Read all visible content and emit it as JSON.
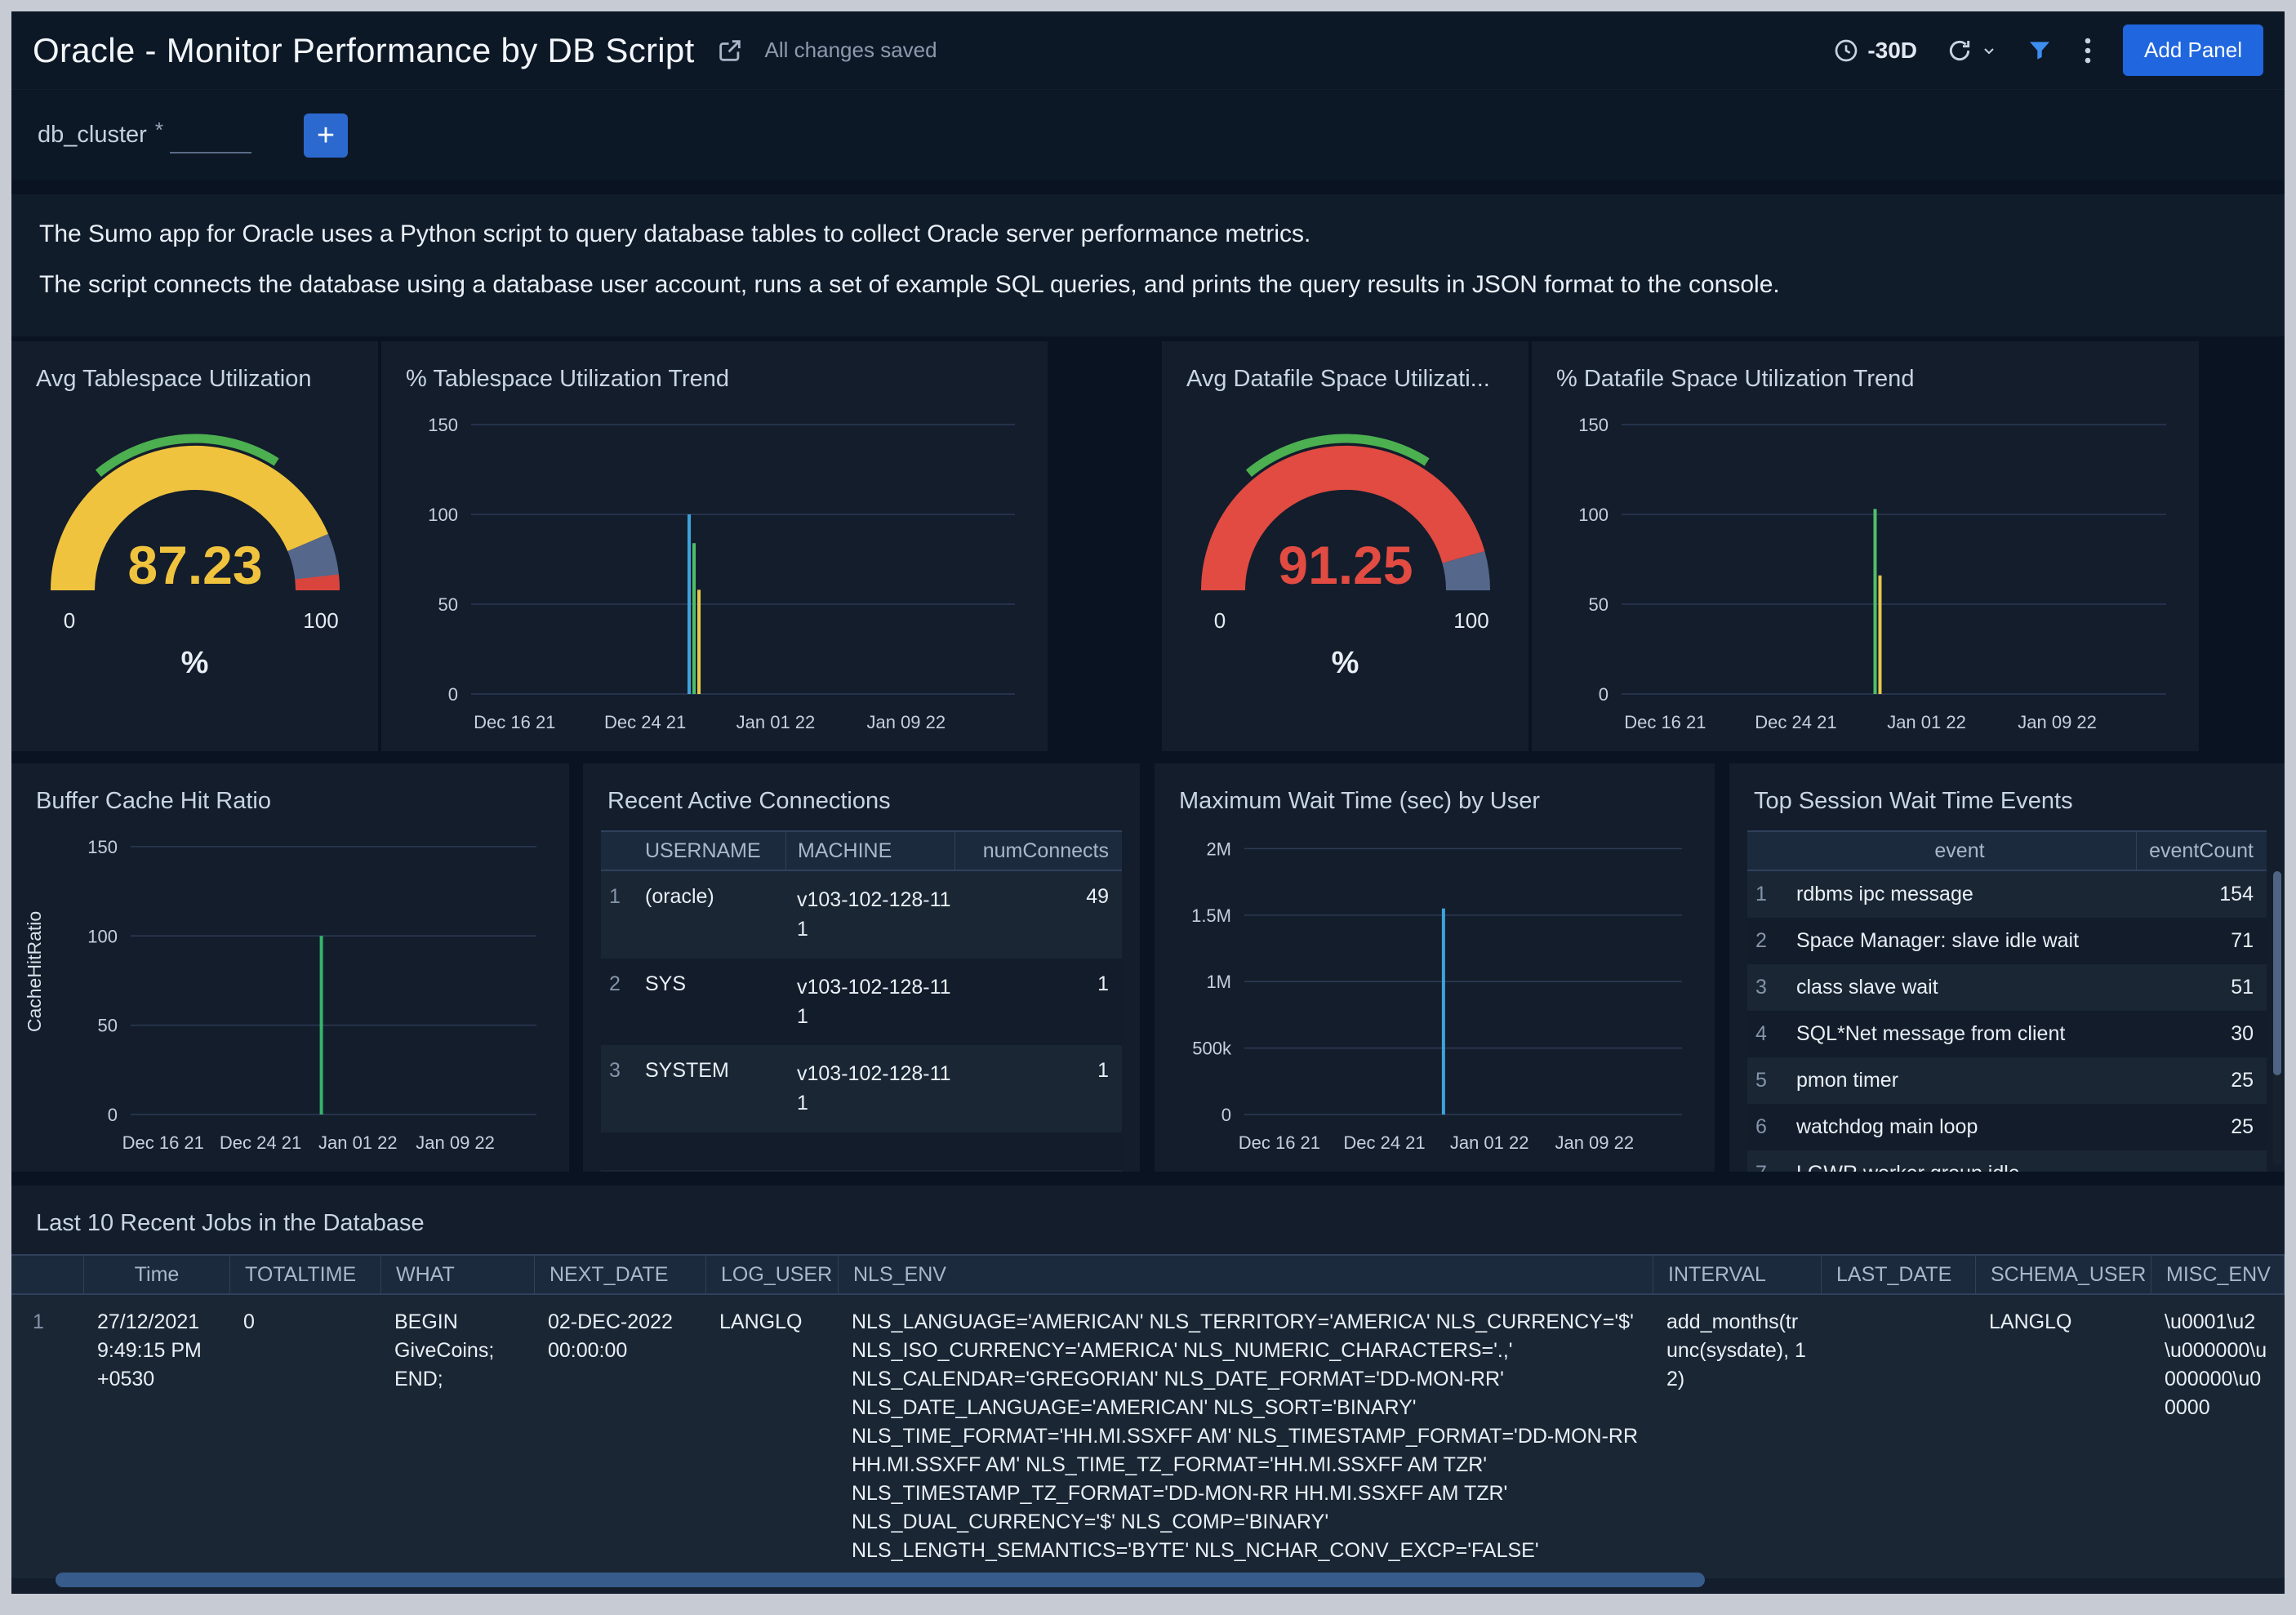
{
  "header": {
    "title": "Oracle - Monitor Performance by DB Script",
    "status": "All changes saved",
    "time_range": "-30D",
    "add_panel": "Add Panel"
  },
  "filter": {
    "label": "db_cluster",
    "required": "*",
    "value": "",
    "add": "+"
  },
  "description": {
    "p1": "The Sumo app for Oracle uses a Python script to query database tables to collect Oracle server performance metrics.",
    "p2": "The script connects the database using a database user account, runs a set of example SQL queries, and prints the query results in JSON format to the console."
  },
  "colors": {
    "accent_blue": "#1F66DF",
    "gauge_yellow": "#F0C33E",
    "gauge_red": "#E14B41",
    "gauge_rest": "#55678B",
    "gauge_band_green": "#4CAF50",
    "spike_blue": "#3FA3DC",
    "spike_green": "#4FC06A",
    "spike_yellow": "#E8C84C"
  },
  "panels": {
    "avg_tablespace": {
      "title": "Avg Tablespace Utilization",
      "unit": "%"
    },
    "tablespace_trend": {
      "title": "% Tablespace Utilization Trend"
    },
    "avg_datafile": {
      "title": "Avg Datafile Space Utilizati...",
      "unit": "%"
    },
    "datafile_trend": {
      "title": "% Datafile Space Utilization Trend"
    },
    "buffer_cache": {
      "title": "Buffer Cache Hit Ratio"
    },
    "connections": {
      "title": "Recent Active Connections",
      "columns": [
        "USERNAME",
        "MACHINE",
        "numConnects"
      ],
      "rows": [
        {
          "n": "1",
          "username": "(oracle)",
          "machine": "v103-102-128-111",
          "numConnects": "49"
        },
        {
          "n": "2",
          "username": "SYS",
          "machine": "v103-102-128-111",
          "numConnects": "1"
        },
        {
          "n": "3",
          "username": "SYSTEM",
          "machine": "v103-102-128-111",
          "numConnects": "1"
        }
      ]
    },
    "max_wait": {
      "title": "Maximum Wait Time (sec) by User"
    },
    "top_wait": {
      "title": "Top Session Wait Time Events",
      "columns": [
        "event",
        "eventCount"
      ],
      "rows": [
        {
          "n": "1",
          "event": "rdbms ipc message",
          "count": "154"
        },
        {
          "n": "2",
          "event": "Space Manager: slave idle wait",
          "count": "71"
        },
        {
          "n": "3",
          "event": "class slave wait",
          "count": "51"
        },
        {
          "n": "4",
          "event": "SQL*Net message from client",
          "count": "30"
        },
        {
          "n": "5",
          "event": "pmon timer",
          "count": "25"
        },
        {
          "n": "6",
          "event": "watchdog main loop",
          "count": "25"
        },
        {
          "n": "7",
          "event": "LGWR worker group idle",
          "count": ""
        }
      ]
    },
    "jobs": {
      "title": "Last 10 Recent Jobs in the Database",
      "columns": [
        "Time",
        "TOTALTIME",
        "WHAT",
        "NEXT_DATE",
        "LOG_USER",
        "NLS_ENV",
        "INTERVAL",
        "LAST_DATE",
        "SCHEMA_USER",
        "MISC_ENV"
      ],
      "row": {
        "n": "1",
        "time": "27/12/2021 9:49:15 PM +0530",
        "totaltime": "0",
        "what": "BEGIN GiveCoins; END;",
        "next_date": "02-DEC-2022 00:00:00",
        "log_user": "LANGLQ",
        "nls_env": "NLS_LANGUAGE='AMERICAN' NLS_TERRITORY='AMERICA' NLS_CURRENCY='$' NLS_ISO_CURRENCY='AMERICA' NLS_NUMERIC_CHARACTERS='.,' NLS_CALENDAR='GREGORIAN' NLS_DATE_FORMAT='DD-MON-RR' NLS_DATE_LANGUAGE='AMERICAN' NLS_SORT='BINARY' NLS_TIME_FORMAT='HH.MI.SSXFF AM' NLS_TIMESTAMP_FORMAT='DD-MON-RR HH.MI.SSXFF AM' NLS_TIME_TZ_FORMAT='HH.MI.SSXFF AM TZR' NLS_TIMESTAMP_TZ_FORMAT='DD-MON-RR HH.MI.SSXFF AM TZR' NLS_DUAL_CURRENCY='$' NLS_COMP='BINARY' NLS_LENGTH_SEMANTICS='BYTE' NLS_NCHAR_CONV_EXCP='FALSE'",
        "interval": "add_months(trunc(sysdate), 12)",
        "last_date": "",
        "schema_user": "LANGLQ",
        "misc_env": "\\u0001\\u2\\u000000\\u000000\\u00000"
      }
    }
  },
  "chart_data": [
    {
      "id": "tablespace_gauge",
      "type": "gauge",
      "title": "Avg Tablespace Utilization",
      "unit": "%",
      "value": 87.23,
      "display": "87.23",
      "min": 0,
      "max": 100,
      "value_color": "#F0C33E",
      "rest_color": "#55678B",
      "segments_after": [
        {
          "from": 96.5,
          "to": 100,
          "color": "#D9453C"
        }
      ],
      "outer_band": {
        "from": 28,
        "to": 68,
        "color": "#4CAF50"
      }
    },
    {
      "id": "tablespace_trend",
      "type": "line",
      "title": "% Tablespace Utilization Trend",
      "x_ticks": [
        "Dec 16 21",
        "Dec 24 21",
        "Jan 01 22",
        "Jan 09 22"
      ],
      "y_ticks": [
        {
          "v": 0,
          "label": "0"
        },
        {
          "v": 50,
          "label": "50"
        },
        {
          "v": 100,
          "label": "100"
        },
        {
          "v": 150,
          "label": "150"
        }
      ],
      "ylim": [
        0,
        160
      ],
      "grid": true,
      "legend": false,
      "spikes": [
        {
          "x_frac": 0.41,
          "x_approx": "Dec 27 21",
          "series": [
            {
              "color": "#3FA3DC",
              "value": 100
            },
            {
              "color": "#4FC06A",
              "value": 84
            },
            {
              "color": "#E8C84C",
              "value": 58
            }
          ]
        }
      ]
    },
    {
      "id": "datafile_gauge",
      "type": "gauge",
      "title": "Avg Datafile Space Utilizati...",
      "unit": "%",
      "value": 91.25,
      "display": "91.25",
      "min": 0,
      "max": 100,
      "value_color": "#E14B41",
      "rest_color": "#55678B",
      "segments_after": [],
      "outer_band": {
        "from": 28,
        "to": 68,
        "color": "#4CAF50"
      }
    },
    {
      "id": "datafile_trend",
      "type": "line",
      "title": "% Datafile Space Utilization Trend",
      "x_ticks": [
        "Dec 16 21",
        "Dec 24 21",
        "Jan 01 22",
        "Jan 09 22"
      ],
      "y_ticks": [
        {
          "v": 0,
          "label": "0"
        },
        {
          "v": 50,
          "label": "50"
        },
        {
          "v": 100,
          "label": "100"
        },
        {
          "v": 150,
          "label": "150"
        }
      ],
      "ylim": [
        0,
        160
      ],
      "grid": true,
      "legend": false,
      "spikes": [
        {
          "x_frac": 0.47,
          "x_approx": "Dec 28 21",
          "series": [
            {
              "color": "#4FC06A",
              "value": 103
            },
            {
              "color": "#E8C84C",
              "value": 66
            }
          ]
        }
      ]
    },
    {
      "id": "buffer_cache",
      "type": "line",
      "title": "Buffer Cache Hit Ratio",
      "ylabel": "CacheHitRatio",
      "x_ticks": [
        "Dec 16 21",
        "Dec 24 21",
        "Jan 01 22",
        "Jan 09 22"
      ],
      "y_ticks": [
        {
          "v": 0,
          "label": "0"
        },
        {
          "v": 50,
          "label": "50"
        },
        {
          "v": 100,
          "label": "100"
        },
        {
          "v": 150,
          "label": "150"
        }
      ],
      "ylim": [
        0,
        160
      ],
      "grid": true,
      "legend": false,
      "spikes": [
        {
          "x_frac": 0.47,
          "x_approx": "Dec 28 21",
          "series": [
            {
              "color": "#35B56A",
              "value": 100
            }
          ]
        }
      ]
    },
    {
      "id": "max_wait",
      "type": "line",
      "title": "Maximum Wait Time (sec) by User",
      "x_ticks": [
        "Dec 16 21",
        "Dec 24 21",
        "Jan 01 22",
        "Jan 09 22"
      ],
      "y_ticks": [
        {
          "v": 0,
          "label": "0"
        },
        {
          "v": 500000,
          "label": "500k"
        },
        {
          "v": 1000000,
          "label": "1M"
        },
        {
          "v": 1500000,
          "label": "1.5M"
        },
        {
          "v": 2000000,
          "label": "2M"
        }
      ],
      "ylim": [
        0,
        2150000
      ],
      "grid": true,
      "legend": false,
      "spikes": [
        {
          "x_frac": 0.455,
          "x_approx": "Dec 28 21",
          "series": [
            {
              "color": "#3FA3DC",
              "value": 1550000
            }
          ]
        }
      ]
    }
  ]
}
